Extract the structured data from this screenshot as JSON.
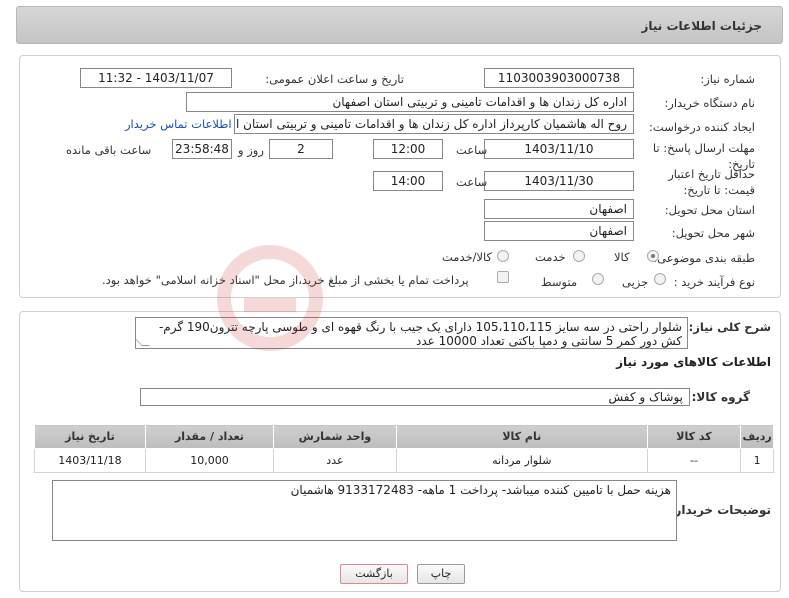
{
  "header": {
    "title": "جزئیات اطلاعات نیاز"
  },
  "form": {
    "need_number_label": "شماره نیاز:",
    "need_number": "1103003903000738",
    "announce_label": "تاریخ و ساعت اعلان عمومی:",
    "announce_value": "1403/11/07 - 11:32",
    "buyer_org_label": "نام دستگاه خریدار:",
    "buyer_org": "اداره کل زندان ها و اقدامات تامینی و تربیتی استان اصفهان",
    "creator_label": "ایجاد کننده درخواست:",
    "creator": "روح اله هاشمیان کارپرداز اداره کل زندان ها و اقدامات تامینی و تربیتی استان اصفهان",
    "contact_link": "اطلاعات تماس خریدار",
    "reply_deadline_label": "مهلت ارسال پاسخ: تا تاریخ:",
    "reply_date": "1403/11/10",
    "time_word": "ساعت",
    "reply_time": "12:00",
    "days_value": "2",
    "days_word": "روز و",
    "remaining_time": "23:58:48",
    "remaining_word": "ساعت باقی مانده",
    "price_validity_label": "حداقل تاریخ اعتبار قیمت: تا تاریخ:",
    "price_date": "1403/11/30",
    "price_time": "14:00",
    "province_label": "استان محل تحویل:",
    "province": "اصفهان",
    "city_label": "شهر محل تحویل:",
    "city": "اصفهان",
    "category_label": "طبقه بندی موضوعی:",
    "category_options": [
      "کالا",
      "خدمت",
      "کالا/خدمت"
    ],
    "purchase_type_label": "نوع فرآیند خرید :",
    "purchase_options": [
      "جزیی",
      "متوسط"
    ],
    "payment_note": "پرداخت تمام یا بخشی از مبلغ خرید،از محل \"اسناد خزانه اسلامی\" خواهد بود."
  },
  "description": {
    "label": "شرح کلی نیاز:",
    "text": "شلوار راحتی در سه سایز 105،110،115 دارای یک جیب با رنگ قهوه ای و طوسی پارچه تترون190 گرم- کش دور کمر 5 سانتی و دمپا باکتی تعداد 10000 عدد"
  },
  "goods": {
    "section_title": "اطلاعات کالاهای مورد نیاز",
    "group_label": "گروه کالا:",
    "group_value": "پوشاک و کفش",
    "columns": [
      "ردیف",
      "کد کالا",
      "نام کالا",
      "واحد شمارش",
      "تعداد / مقدار",
      "تاریخ نیاز"
    ],
    "rows": [
      [
        "1",
        "--",
        "شلوار مردانه",
        "عدد",
        "10,000",
        "1403/11/18"
      ]
    ]
  },
  "buyer_notes": {
    "label": "توضیحات خریدار:",
    "text": "هزینه حمل با تامیین کننده میباشد- پرداخت 1 ماهه- 9133172483 هاشمیان"
  },
  "buttons": {
    "print": "چاپ",
    "back": "بازگشت"
  },
  "watermark": "AriaTender.neT",
  "colors": {
    "header_bg": "#cacaca",
    "link": "#1a4fb5",
    "table_header": "#c6c6c6",
    "back_button_border": "#d88"
  }
}
